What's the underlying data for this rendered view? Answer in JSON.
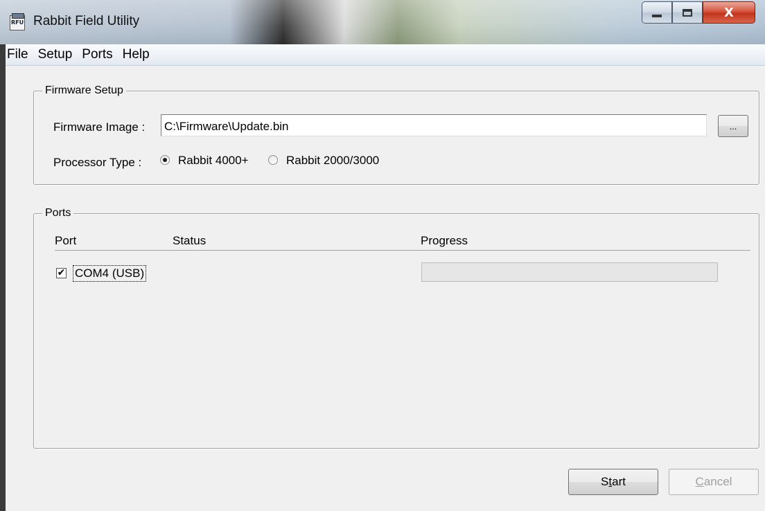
{
  "window": {
    "title": "Rabbit Field Utility",
    "icon_text": "RFU",
    "minimize_icon": "minimize-icon",
    "maximize_icon": "maximize-icon",
    "close_icon": "close-icon",
    "close_glyph": "X"
  },
  "menu": {
    "items": [
      "File",
      "Setup",
      "Ports",
      "Help"
    ]
  },
  "firmware_setup": {
    "legend": "Firmware Setup",
    "image_label": "Firmware Image :",
    "image_value": "C:\\Firmware\\Update.bin",
    "browse_label": "...",
    "processor_label": "Processor Type :",
    "processor_options": [
      {
        "label": "Rabbit 4000+",
        "checked": true
      },
      {
        "label": "Rabbit 2000/3000",
        "checked": false
      }
    ]
  },
  "ports": {
    "legend": "Ports",
    "columns": [
      "Port",
      "Status",
      "Progress"
    ],
    "rows": [
      {
        "port": "COM4 (USB)",
        "checked": true,
        "checkmark": "✔",
        "status": "",
        "progress": 0
      }
    ]
  },
  "actions": {
    "start_prefix": "S",
    "start_mnemonic": "t",
    "start_suffix": "art",
    "cancel_prefix": "",
    "cancel_mnemonic": "C",
    "cancel_suffix": "ancel",
    "cancel_disabled": true
  },
  "colors": {
    "client_bg": "#f0f0f0",
    "progress_fill": "#06b025",
    "disabled_text": "#a0a0a0"
  }
}
